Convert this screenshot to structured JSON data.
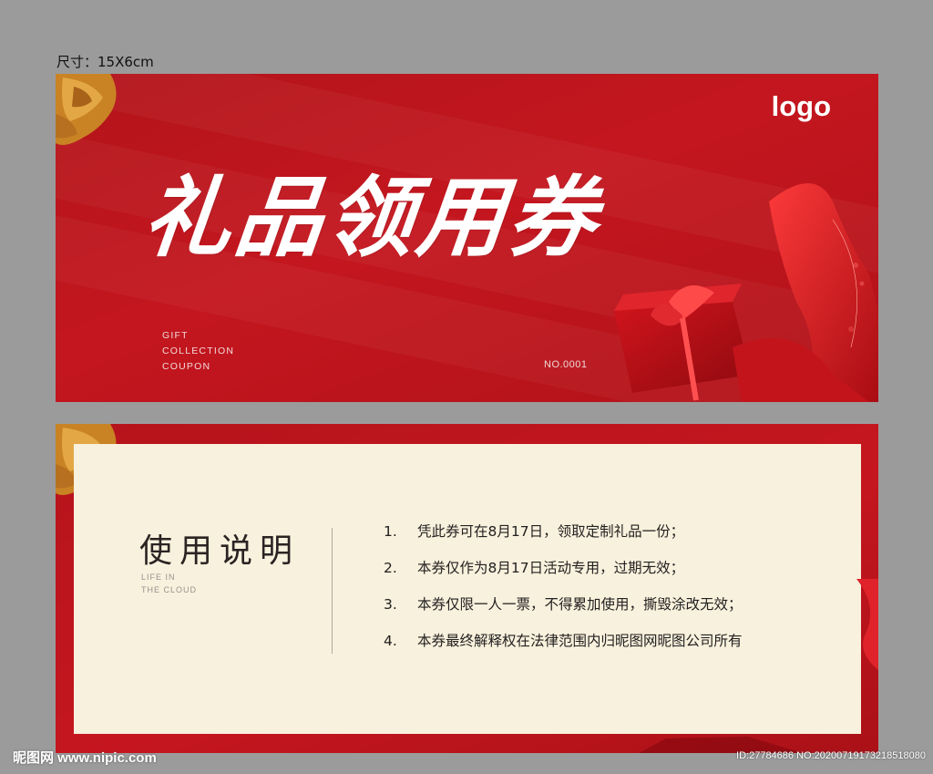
{
  "size_label": "尺寸：15X6cm",
  "front": {
    "logo": "logo",
    "title": "礼品领用券",
    "subtitle_lines": [
      "GIFT",
      "COLLECTION",
      "COUPON"
    ],
    "serial_no": "NO.0001"
  },
  "back": {
    "title": "使用说明",
    "subtitle_lines": [
      "LIFE IN",
      "THE CLOUD"
    ],
    "rules": [
      {
        "num": "1.",
        "text": "凭此券可在8月17日，领取定制礼品一份；"
      },
      {
        "num": "2.",
        "text": "本券仅作为8月17日活动专用，过期无效；"
      },
      {
        "num": "3.",
        "text": "本券仅限一人一票，不得累加使用，撕毁涂改无效；"
      },
      {
        "num": "4.",
        "text": "本券最终解释权在法律范围内归昵图网昵图公司所有"
      }
    ]
  },
  "watermark": {
    "left": "昵图网 www.nipic.com",
    "right": "ID:27784686 NO:20200719173218518080"
  },
  "colors": {
    "card_red": "#c4161f",
    "panel_cream": "#f8f1dd",
    "background_gray": "#9b9b9b",
    "bow_gold": "#d18a25"
  }
}
